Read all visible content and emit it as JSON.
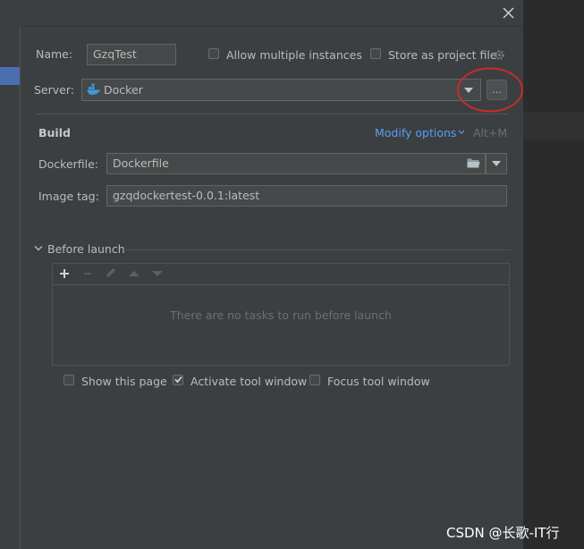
{
  "form": {
    "name_label": "Name:",
    "name_value": "GzqTest",
    "allow_multiple": "Allow multiple instances",
    "store_project_file": "Store as project file",
    "server_label": "Server:",
    "server_value": "Docker",
    "ellipsis_label": "..."
  },
  "build": {
    "header": "Build",
    "modify_options": "Modify options",
    "shortcut": "Alt+M",
    "dockerfile_label": "Dockerfile:",
    "dockerfile_value": "Dockerfile",
    "image_tag_label": "Image tag:",
    "image_tag_value": "gzqdockertest-0.0.1:latest"
  },
  "before_launch": {
    "header": "Before launch",
    "empty_text": "There are no tasks to run before launch"
  },
  "options": {
    "show_page": "Show this page",
    "activate_tool": "Activate tool window",
    "focus_tool": "Focus tool window",
    "show_page_checked": false,
    "activate_tool_checked": true,
    "focus_tool_checked": false
  },
  "watermark": "CSDN @长歌-IT行",
  "icons": [
    "close-icon",
    "gear-icon",
    "docker-whale-icon",
    "chevron-down-icon",
    "folder-icon",
    "plus-icon",
    "minus-icon",
    "pencil-icon",
    "arrow-up-icon",
    "arrow-down-icon",
    "check-icon"
  ],
  "colors": {
    "dialog_bg": "#3c3f41",
    "link": "#589df6",
    "highlight_circle": "#cc2a2a",
    "selection": "#4b6eaf"
  }
}
